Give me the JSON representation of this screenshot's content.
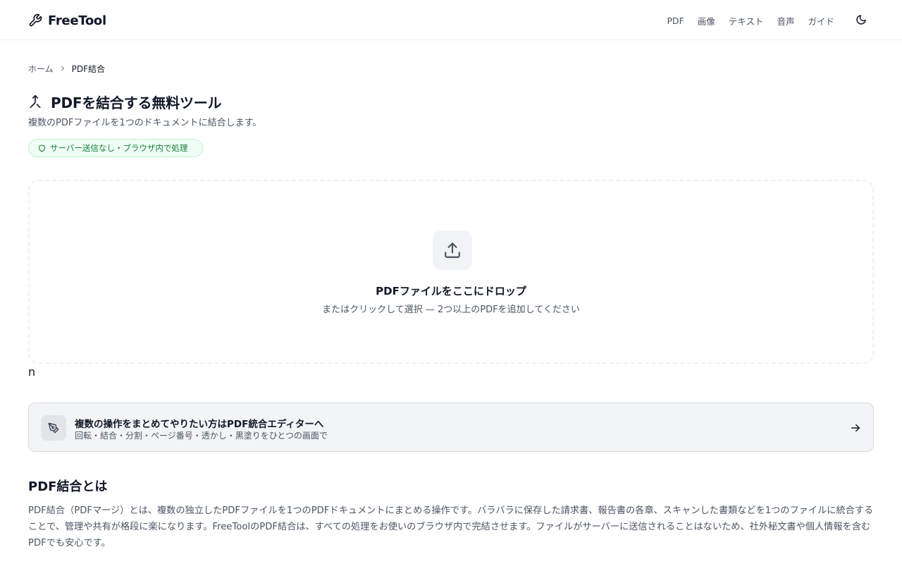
{
  "header": {
    "logo_text": "FreeTool",
    "logo_icon": "wrench-icon",
    "nav": [
      {
        "label": "PDF"
      },
      {
        "label": "画像"
      },
      {
        "label": "テキスト"
      },
      {
        "label": "音声"
      },
      {
        "label": "ガイド"
      }
    ],
    "theme_toggle_icon": "moon-icon"
  },
  "breadcrumb": {
    "home": "ホーム",
    "separator_icon": "chevron-right-icon",
    "current": "PDF結合"
  },
  "page": {
    "title_icon": "merge-icon",
    "title": "PDFを結合する無料ツール",
    "subtitle": "複数のPDFファイルを1つのドキュメントに結合します。",
    "privacy_badge": "サーバー送信なし・ブラウザ内で処理",
    "privacy_icon": "shield-icon"
  },
  "dropzone": {
    "icon": "upload-icon",
    "title": "PDFファイルをここにドロップ",
    "subtitle": "またはクリックして選択 — 2つ以上のPDFを追加してください"
  },
  "stray_text": "n",
  "editor_banner": {
    "icon": "pen-tool-icon",
    "title": "複数の操作をまとめてやりたい方はPDF統合エディターへ",
    "subtitle": "回転・結合・分割・ページ番号・透かし・黒塗りをひとつの画面で",
    "arrow_icon": "arrow-right-icon"
  },
  "section": {
    "heading": "PDF結合とは",
    "body": "PDF結合（PDFマージ）とは、複数の独立したPDFファイルを1つのPDFドキュメントにまとめる操作です。バラバラに保存した請求書、報告書の各章、スキャンした書類などを1つのファイルに統合することで、管理や共有が格段に楽になります。FreeToolのPDF結合は、すべての処理をお使いのブラウザ内で完結させます。ファイルがサーバーに送信されることはないため、社外秘文書や個人情報を含むPDFでも安心です。"
  },
  "colors": {
    "text": "#111827",
    "muted": "#4b5563",
    "badge_green": "#15803d",
    "badge_bg": "#f0fdf4"
  }
}
